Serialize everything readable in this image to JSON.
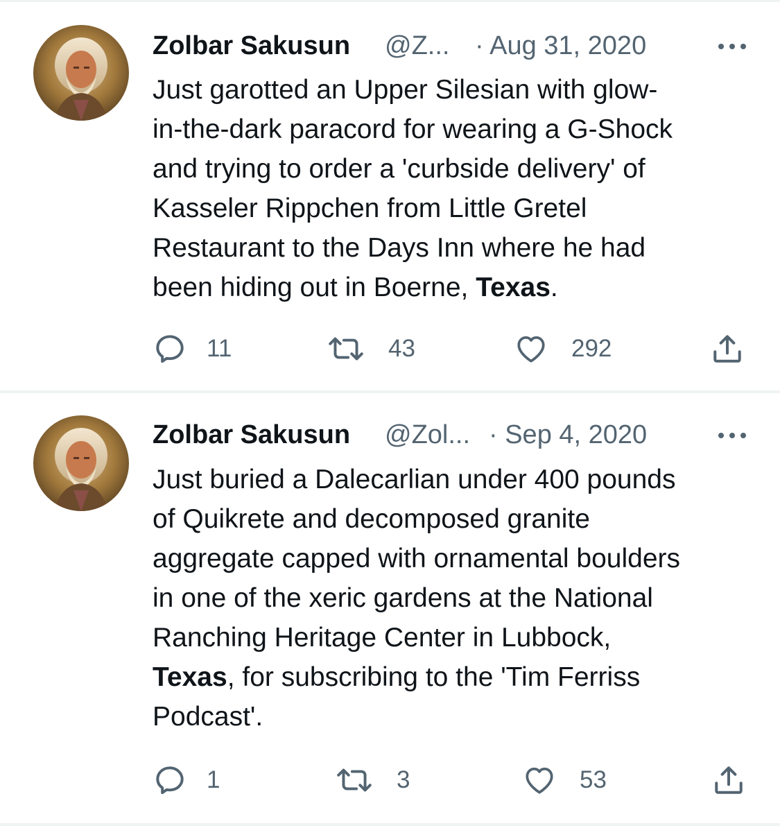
{
  "tweets": [
    {
      "author": {
        "name": "Zolbar Sakusun",
        "handle": "@Z...",
        "avatar": "avatar-portrait-icon"
      },
      "date": "· Aug 31, 2020",
      "text_lines": [
        "Just garotted an Upper Silesian with glow-",
        "in-the-dark paracord for wearing a G-Shock",
        "and trying to order a 'curbside delivery' of",
        "Kasseler Rippchen from Little Gretel",
        "Restaurant to the Days Inn where he had",
        "been hiding out in Boerne, "
      ],
      "text_bold": "Texas",
      "text_tail": ".",
      "stats": {
        "replies": "11",
        "retweets": "43",
        "likes": "292"
      }
    },
    {
      "author": {
        "name": "Zolbar Sakusun",
        "handle": "@Zol...",
        "avatar": "avatar-portrait-icon"
      },
      "date": "· Sep 4, 2020",
      "text_lines": [
        "Just buried a Dalecarlian under 400 pounds",
        "of Quikrete and decomposed granite",
        "aggregate capped with ornamental boulders",
        "in one of the xeric gardens at the National",
        "Ranching Heritage Center in Lubbock,"
      ],
      "text_bold": "Texas",
      "text_tail": ", for subscribing to the 'Tim Ferriss",
      "text_last": "Podcast'.",
      "stats": {
        "replies": "1",
        "retweets": "3",
        "likes": "53"
      }
    }
  ],
  "colors": {
    "text": "#0f1419",
    "secondary": "#536471",
    "divider": "#eff3f4"
  },
  "icons": [
    "more-icon",
    "reply-icon",
    "retweet-icon",
    "like-icon",
    "share-icon"
  ]
}
